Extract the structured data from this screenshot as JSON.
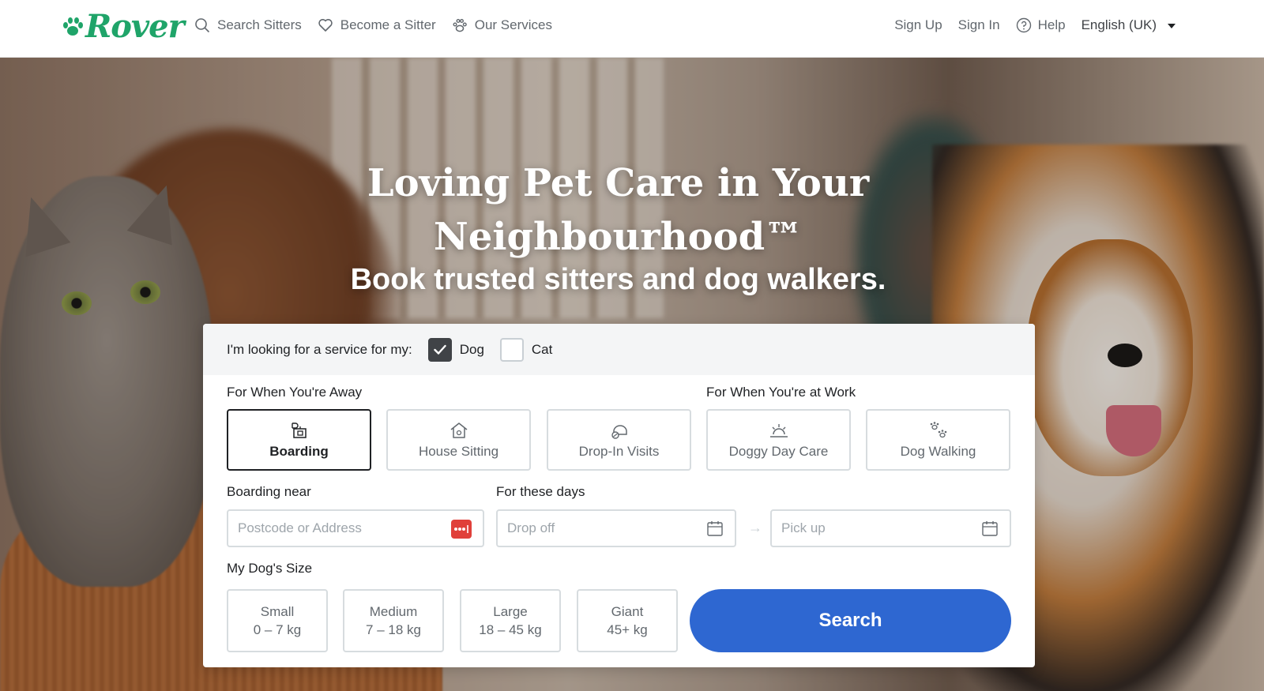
{
  "brand": {
    "name": "Rover",
    "color": "#1fa469"
  },
  "nav": {
    "left": [
      {
        "label": "Search Sitters",
        "icon": "search-icon"
      },
      {
        "label": "Become a Sitter",
        "icon": "heart-icon"
      },
      {
        "label": "Our Services",
        "icon": "paw-icon"
      }
    ],
    "right": {
      "sign_up": "Sign Up",
      "sign_in": "Sign In",
      "help": "Help",
      "language": "English (UK)"
    }
  },
  "hero": {
    "title_line1": "Loving Pet Care in Your",
    "title_line2": "Neighbourhood™",
    "subtitle": "Book trusted sitters and dog walkers."
  },
  "search": {
    "pet_prompt": "I'm looking for a service for my:",
    "pets": [
      {
        "label": "Dog",
        "checked": true
      },
      {
        "label": "Cat",
        "checked": false
      }
    ],
    "away_label": "For When You're Away",
    "work_label": "For When You're at Work",
    "services": [
      {
        "label": "Boarding",
        "icon": "boarding-icon",
        "selected": true
      },
      {
        "label": "House Sitting",
        "icon": "house-icon",
        "selected": false
      },
      {
        "label": "Drop-In Visits",
        "icon": "drop-in-icon",
        "selected": false
      },
      {
        "label": "Doggy Day Care",
        "icon": "sun-icon",
        "selected": false
      },
      {
        "label": "Dog Walking",
        "icon": "paw-prints-icon",
        "selected": false
      }
    ],
    "near_label": "Boarding near",
    "address_placeholder": "Postcode or Address",
    "days_label": "For these days",
    "drop_off_placeholder": "Drop off",
    "pick_up_placeholder": "Pick up",
    "size_label": "My Dog's Size",
    "sizes": [
      {
        "name": "Small",
        "range": "0 – 7 kg"
      },
      {
        "name": "Medium",
        "range": "7 – 18 kg"
      },
      {
        "name": "Large",
        "range": "18 – 45 kg"
      },
      {
        "name": "Giant",
        "range": "45+ kg"
      }
    ],
    "search_button": "Search",
    "accent_color": "#2e67d1"
  }
}
